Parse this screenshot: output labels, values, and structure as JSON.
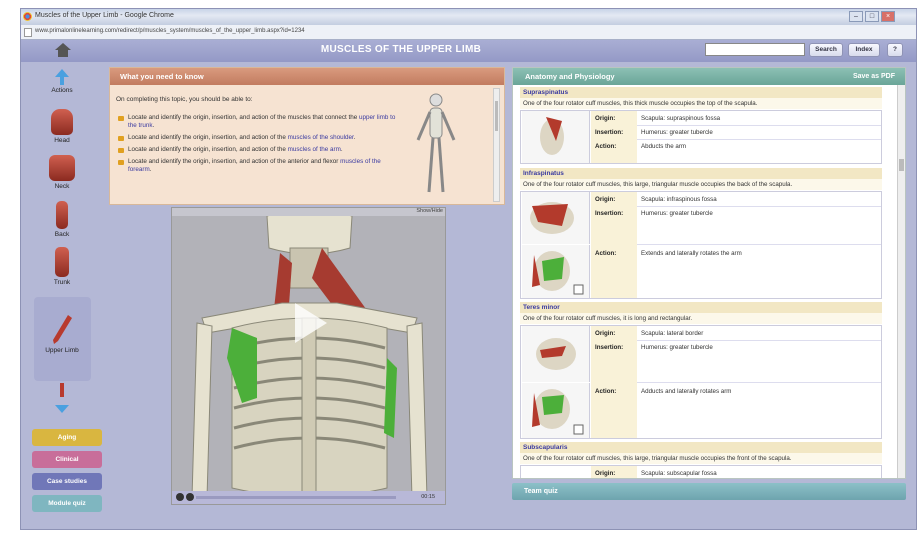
{
  "window": {
    "title": "Muscles of the Upper Limb - Google Chrome",
    "url": "www.primalonlinelearning.com/redirect/p/muscles_system/muscles_of_the_upper_limb.aspx?id=1234"
  },
  "header": {
    "title": "MUSCLES OF THE UPPER LIMB",
    "search_label": "Search",
    "index_label": "Index",
    "help_label": "?"
  },
  "sidebar": {
    "items": [
      {
        "label": "Actions"
      },
      {
        "label": "Head"
      },
      {
        "label": "Neck"
      },
      {
        "label": "Back"
      },
      {
        "label": "Trunk"
      },
      {
        "label": "Upper Limb"
      }
    ],
    "buttons": [
      {
        "label": "Aging",
        "color": "#d9b640"
      },
      {
        "label": "Clinical",
        "color": "#c86e9a"
      },
      {
        "label": "Case studies",
        "color": "#7077b8"
      },
      {
        "label": "Module quiz",
        "color": "#7fb6c0"
      }
    ]
  },
  "what_you_need": {
    "title": "What you need to know",
    "intro": "On completing this topic, you should be able to:",
    "objectives": [
      {
        "text": "Locate and identify the origin, insertion, and action of the muscles that connect the ",
        "link": "upper limb to the trunk",
        "tail": "."
      },
      {
        "text": "Locate and identify the origin, insertion, and action of the ",
        "link": "muscles of the shoulder",
        "tail": "."
      },
      {
        "text": "Locate and identify the origin, insertion, and action of the ",
        "link": "muscles of the arm",
        "tail": "."
      },
      {
        "text": "Locate and identify the origin, insertion, and action of the anterior and flexor ",
        "link": "muscles of the forearm",
        "tail": "."
      }
    ]
  },
  "video": {
    "show_hide": "Show/Hide",
    "time": "00:15"
  },
  "anatomy_panel": {
    "title": "Anatomy and Physiology",
    "save_pdf": "Save as PDF",
    "labels": {
      "origin": "Origin:",
      "insertion": "Insertion:",
      "action": "Action:"
    },
    "muscles": [
      {
        "name": "Supraspinatus",
        "desc": "One of the four rotator cuff muscles, this thick muscle occupies the top of the scapula.",
        "origin": "Scapula: supraspinous fossa",
        "insertion": "Humerus: greater tubercle",
        "action": "Abducts the arm"
      },
      {
        "name": "Infraspinatus",
        "desc": "One of the four rotator cuff muscles, this large, triangular muscle occupies the back of the scapula.",
        "origin": "Scapula: infraspinous fossa",
        "insertion": "Humerus: greater tubercle",
        "action": "Extends and laterally rotates the arm"
      },
      {
        "name": "Teres minor",
        "desc": "One of the four rotator cuff muscles, it is long and rectangular.",
        "origin": "Scapula: lateral border",
        "insertion": "Humerus: greater tubercle",
        "action": "Adducts and laterally rotates arm"
      },
      {
        "name": "Subscapularis",
        "desc": "One of the four rotator cuff muscles, this large, triangular muscle occupies the front of the scapula.",
        "origin": "Scapula: subscapular fossa"
      }
    ]
  },
  "team_quiz": "Team quiz"
}
